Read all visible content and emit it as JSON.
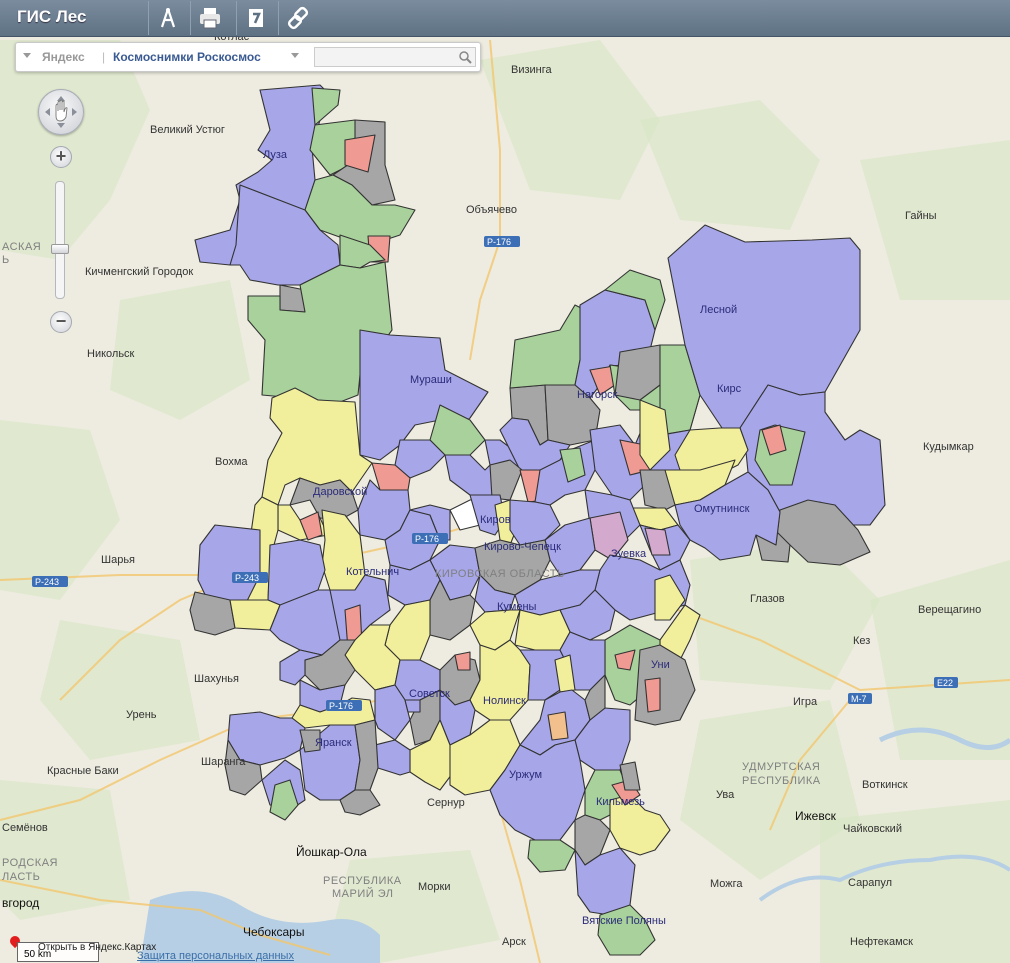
{
  "app": {
    "title": "ГИС Лес"
  },
  "toolbar": [
    {
      "name": "measure-tool-button",
      "icon": "compass-icon"
    },
    {
      "name": "print-button",
      "icon": "printer-icon"
    },
    {
      "name": "notes-button",
      "icon": "note-icon"
    },
    {
      "name": "link-button",
      "icon": "link-icon"
    }
  ],
  "layers": {
    "yandex": "Яндекс",
    "separator": "|",
    "kosmo": "Космоснимки Роскосмос",
    "search_placeholder": ""
  },
  "zoom": {
    "in": "+",
    "out": "−"
  },
  "colors": {
    "blue": "#a7a6e8",
    "green": "#a8d19b",
    "gray": "#a6a6a6",
    "yellow": "#f2ef9c",
    "red": "#ef9a92",
    "orange": "#f1c08d",
    "pink": "#d3a9cd",
    "white": "#ffffff",
    "border": "#333333",
    "base": "#eeece0",
    "road": "#f2c56d",
    "water": "#b6cfe4"
  },
  "cities": [
    {
      "name": "Котлас",
      "cls": "map-label"
    },
    {
      "name": "Визинга",
      "cls": "map-label"
    },
    {
      "name": "Великий Устюг",
      "cls": "map-label"
    },
    {
      "name": "Объячево",
      "cls": "map-label"
    },
    {
      "name": "Гайны",
      "cls": "map-label"
    },
    {
      "name": "Кичменгский Городок",
      "cls": "map-label"
    },
    {
      "name": "Никольск",
      "cls": "map-label"
    },
    {
      "name": "Кудымкар",
      "cls": "map-label"
    },
    {
      "name": "Вохма",
      "cls": "map-label"
    },
    {
      "name": "Шарья",
      "cls": "map-label"
    },
    {
      "name": "Глазов",
      "cls": "map-label"
    },
    {
      "name": "Верещагино",
      "cls": "map-label"
    },
    {
      "name": "Кез",
      "cls": "map-label"
    },
    {
      "name": "Шахунья",
      "cls": "map-label"
    },
    {
      "name": "Игра",
      "cls": "map-label"
    },
    {
      "name": "Урень",
      "cls": "map-label"
    },
    {
      "name": "Шаранга",
      "cls": "map-label"
    },
    {
      "name": "Красные Баки",
      "cls": "map-label"
    },
    {
      "name": "Ува",
      "cls": "map-label"
    },
    {
      "name": "Воткинск",
      "cls": "map-label"
    },
    {
      "name": "Ижевск",
      "cls": "map-label-big"
    },
    {
      "name": "Чайковский",
      "cls": "map-label"
    },
    {
      "name": "Семёнов",
      "cls": "map-label"
    },
    {
      "name": "Йошкар-Ола",
      "cls": "map-label-big"
    },
    {
      "name": "Сернур",
      "cls": "map-label"
    },
    {
      "name": "Морки",
      "cls": "map-label"
    },
    {
      "name": "Можга",
      "cls": "map-label"
    },
    {
      "name": "Сарапул",
      "cls": "map-label"
    },
    {
      "name": "Чебоксары",
      "cls": "map-label-big"
    },
    {
      "name": "Арск",
      "cls": "map-label"
    },
    {
      "name": "Нефтекамск",
      "cls": "map-label"
    },
    {
      "name": "вгород",
      "cls": "map-label-big"
    }
  ],
  "regions": [
    {
      "name": "КИРОВСКАЯ ОБЛАСТЬ"
    },
    {
      "name": "УДМУРТСКАЯ"
    },
    {
      "name": "РЕСПУБЛИКА"
    },
    {
      "name": "РЕСПУБЛИКА"
    },
    {
      "name": "МАРИЙ ЭЛ"
    },
    {
      "name": "РОДСКАЯ"
    },
    {
      "name": "ЛАСТЬ"
    },
    {
      "name": "АСКАЯ"
    },
    {
      "name": "Ь"
    }
  ],
  "districts": [
    "Луза",
    "Мураши",
    "Лесной",
    "Нагорск",
    "Кирс",
    "Даровской",
    "Омутнинск",
    "Киров",
    "Кирово-Чепецк",
    "Зуевка",
    "Котельнич",
    "Кумены",
    "Уни",
    "Советск",
    "Нолинск",
    "Яранск",
    "Уржум",
    "Кильмезь",
    "Вятские Поляны"
  ],
  "roads": [
    "Р-176",
    "Р-176",
    "Р-243",
    "Р-243",
    "Р-176",
    "М-7",
    "E22"
  ],
  "footer": {
    "scale": "50 km",
    "open_in_yandex": "Открыть в Яндекс.Картах",
    "privacy": "Защита персональных данных"
  }
}
